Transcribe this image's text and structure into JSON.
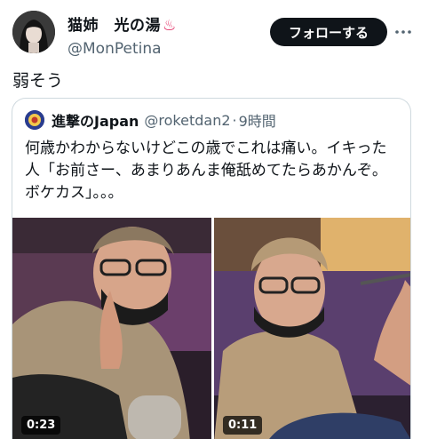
{
  "author": {
    "display_name": "猫姉　光の湯",
    "hot_spring_glyph": "♨",
    "handle": "@MonPetina",
    "avatar_icon": "profile-photo"
  },
  "follow_button": {
    "label": "フォローする"
  },
  "more_icon": "more-icon",
  "tweet_text": "弱そう",
  "quoted": {
    "name": "進撃のJapan",
    "handle": "@roketdan2",
    "separator": "·",
    "time": "9時間",
    "text": "何歳かわからないけどこの歳でこれは痛い。イキった人「お前さー、あまりあんま俺舐めてたらあかんぞ。ボケカス」。。。",
    "media": [
      {
        "duration": "0:23"
      },
      {
        "duration": "0:11"
      }
    ]
  },
  "colors": {
    "follow_bg": "#0f1419",
    "text_primary": "#0f1419",
    "text_secondary": "#536471",
    "border": "#cfd9de"
  }
}
